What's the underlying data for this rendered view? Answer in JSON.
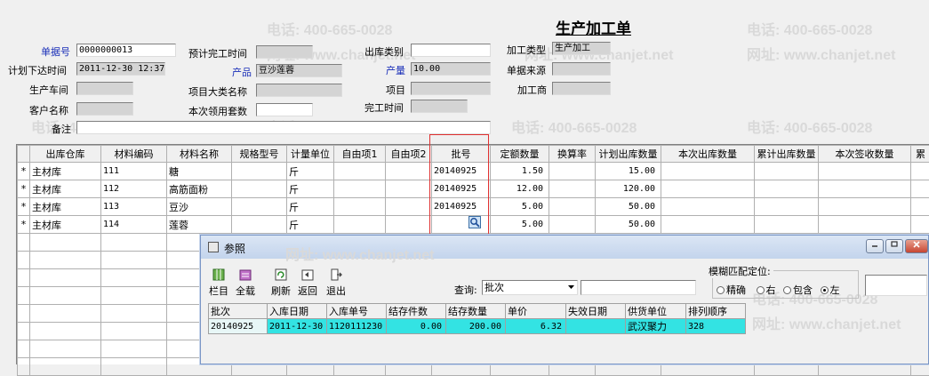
{
  "watermarks": {
    "phone": "电话: 400-665-0028",
    "url": "网址: www.chanjet.net"
  },
  "form": {
    "title": "生产加工单",
    "fields": {
      "doc_no": {
        "label": "单据号",
        "value": "0000000013"
      },
      "plan_time": {
        "label": "计划下达时间",
        "value": "2011-12-30  12:37"
      },
      "workshop": {
        "label": "生产车间",
        "value": ""
      },
      "customer": {
        "label": "客户名称",
        "value": ""
      },
      "remark": {
        "label": "备注",
        "value": ""
      },
      "est_finish": {
        "label": "预计完工时间",
        "value": ""
      },
      "product": {
        "label": "产品",
        "value": "豆沙莲蓉"
      },
      "category": {
        "label": "项目大类名称",
        "value": ""
      },
      "sets": {
        "label": "本次领用套数",
        "value": ""
      },
      "out_type": {
        "label": "出库类别",
        "value": ""
      },
      "quantity": {
        "label": "产量",
        "value": "10.00"
      },
      "project": {
        "label": "项目",
        "value": ""
      },
      "finish_time": {
        "label": "完工时间",
        "value": ""
      },
      "process_type": {
        "label": "加工类型",
        "value": "生产加工"
      },
      "source": {
        "label": "单据来源",
        "value": ""
      },
      "processor": {
        "label": "加工商",
        "value": ""
      }
    }
  },
  "grid": {
    "columns": [
      "出库仓库",
      "材料编码",
      "材料名称",
      "规格型号",
      "计量单位",
      "自由项1",
      "自由项2",
      "批号",
      "定额数量",
      "换算率",
      "计划出库数量",
      "本次出库数量",
      "累计出库数量",
      "本次签收数量",
      "累"
    ],
    "rows": [
      {
        "marker": "*",
        "warehouse": "主材库",
        "code": "111",
        "name": "糖",
        "spec": "",
        "unit": "斤",
        "f1": "",
        "f2": "",
        "batch": "20140925",
        "quota": "1.50",
        "rate": "",
        "plan": "15.00",
        "cur": "",
        "cum": "",
        "sign": ""
      },
      {
        "marker": "*",
        "warehouse": "主材库",
        "code": "112",
        "name": "高筋面粉",
        "spec": "",
        "unit": "斤",
        "f1": "",
        "f2": "",
        "batch": "20140925",
        "quota": "12.00",
        "rate": "",
        "plan": "120.00",
        "cur": "",
        "cum": "",
        "sign": ""
      },
      {
        "marker": "*",
        "warehouse": "主材库",
        "code": "113",
        "name": "豆沙",
        "spec": "",
        "unit": "斤",
        "f1": "",
        "f2": "",
        "batch": "20140925",
        "quota": "5.00",
        "rate": "",
        "plan": "50.00",
        "cur": "",
        "cum": "",
        "sign": ""
      },
      {
        "marker": "*",
        "warehouse": "主材库",
        "code": "114",
        "name": "莲蓉",
        "spec": "",
        "unit": "斤",
        "f1": "",
        "f2": "",
        "batch": "",
        "quota": "5.00",
        "rate": "",
        "plan": "50.00",
        "cur": "",
        "cum": "",
        "sign": ""
      }
    ]
  },
  "dialog": {
    "title": "参照",
    "toolbar": {
      "columns": "栏目",
      "load_all": "全载",
      "refresh": "刷新",
      "back": "返回",
      "exit": "退出"
    },
    "query": {
      "label": "查询:",
      "selected": "批次",
      "search_value": ""
    },
    "fuzzy": {
      "legend": "模糊匹配定位:",
      "options": [
        "精确",
        "右",
        "包含",
        "左"
      ],
      "selected": "左"
    },
    "table": {
      "columns": [
        "批次",
        "入库日期",
        "入库单号",
        "结存件数",
        "结存数量",
        "单价",
        "失效日期",
        "供货单位",
        "排列顺序"
      ],
      "rows": [
        {
          "batch": "20140925",
          "in_date": "2011-12-30",
          "in_no": "1120111230",
          "pieces": "0.00",
          "qty": "200.00",
          "price": "6.32",
          "expire": "",
          "supplier": "武汉聚力",
          "order": "328"
        }
      ]
    }
  },
  "colors": {
    "accent": "#1a2fb8",
    "highlight": "#33e3e3",
    "outline": "#e03030"
  }
}
